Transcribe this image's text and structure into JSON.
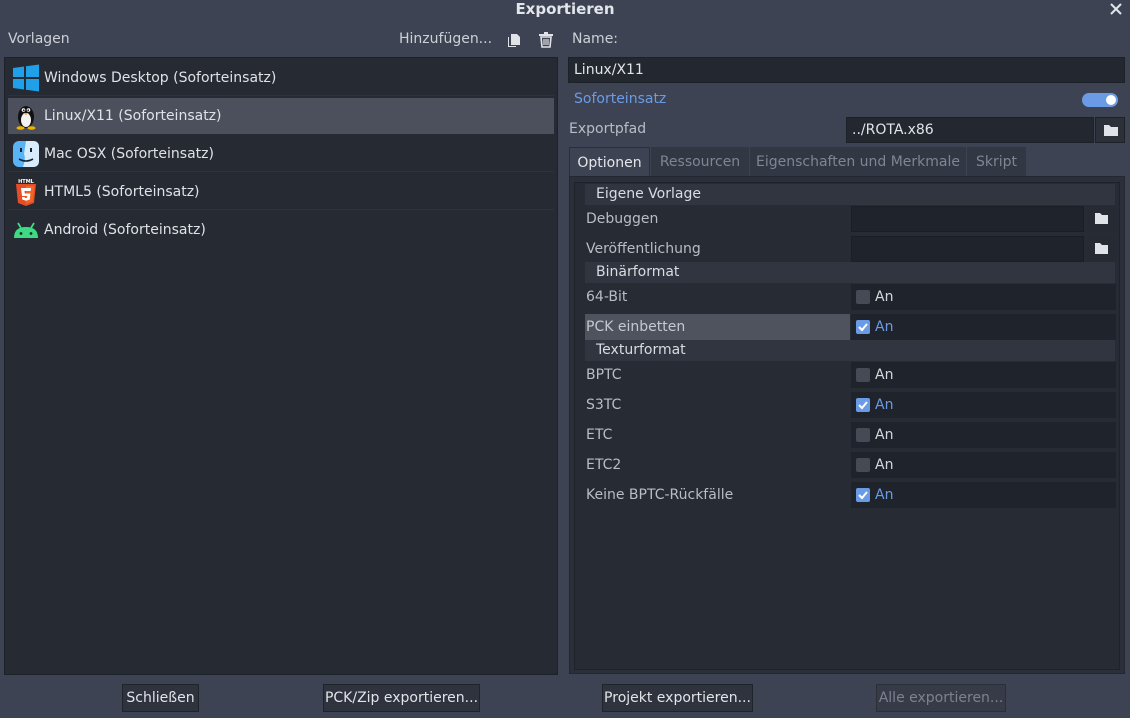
{
  "window": {
    "title": "Exportieren"
  },
  "presets": {
    "label": "Vorlagen",
    "add_label": "Hinzufügen...",
    "items": [
      {
        "label": "Windows Desktop (Soforteinsatz)",
        "icon": "windows-icon"
      },
      {
        "label": "Linux/X11 (Soforteinsatz)",
        "icon": "linux-tux-icon",
        "selected": true
      },
      {
        "label": "Mac OSX (Soforteinsatz)",
        "icon": "macos-finder-icon"
      },
      {
        "label": "HTML5 (Soforteinsatz)",
        "icon": "html5-icon"
      },
      {
        "label": "Android (Soforteinsatz)",
        "icon": "android-icon"
      }
    ]
  },
  "details": {
    "name_label": "Name:",
    "name_value": "Linux/X11",
    "runnable_label": "Soforteinsatz",
    "runnable_on": true,
    "export_path_label": "Exportpfad",
    "export_path_value": "../ROTA.x86",
    "tabs": [
      "Optionen",
      "Ressourcen",
      "Eigenschaften und Merkmale",
      "Skript"
    ],
    "active_tab": "Optionen"
  },
  "options": {
    "custom_template": {
      "section": "Eigene Vorlage",
      "debug_label": "Debuggen",
      "debug_value": "",
      "release_label": "Veröffentlichung",
      "release_value": ""
    },
    "binary_format": {
      "section": "Binärformat",
      "bit64_label": "64-Bit",
      "bit64_on": false,
      "embed_pck_label": "PCK einbetten",
      "embed_pck_on": true
    },
    "texture_format": {
      "section": "Texturformat",
      "bptc_label": "BPTC",
      "s3tc_label": "S3TC",
      "etc_label": "ETC",
      "etc2_label": "ETC2",
      "no_bptc_fallbacks_label": "Keine BPTC-Rückfälle"
    },
    "checkbox_text": "An"
  },
  "buttons": {
    "close": "Schließen",
    "export_pck": "PCK/Zip exportieren...",
    "export_project": "Projekt exportieren...",
    "export_all": "Alle exportieren..."
  },
  "colors": {
    "accent": "#6c9be6",
    "background": "#3d4352",
    "panel": "#252a33"
  }
}
